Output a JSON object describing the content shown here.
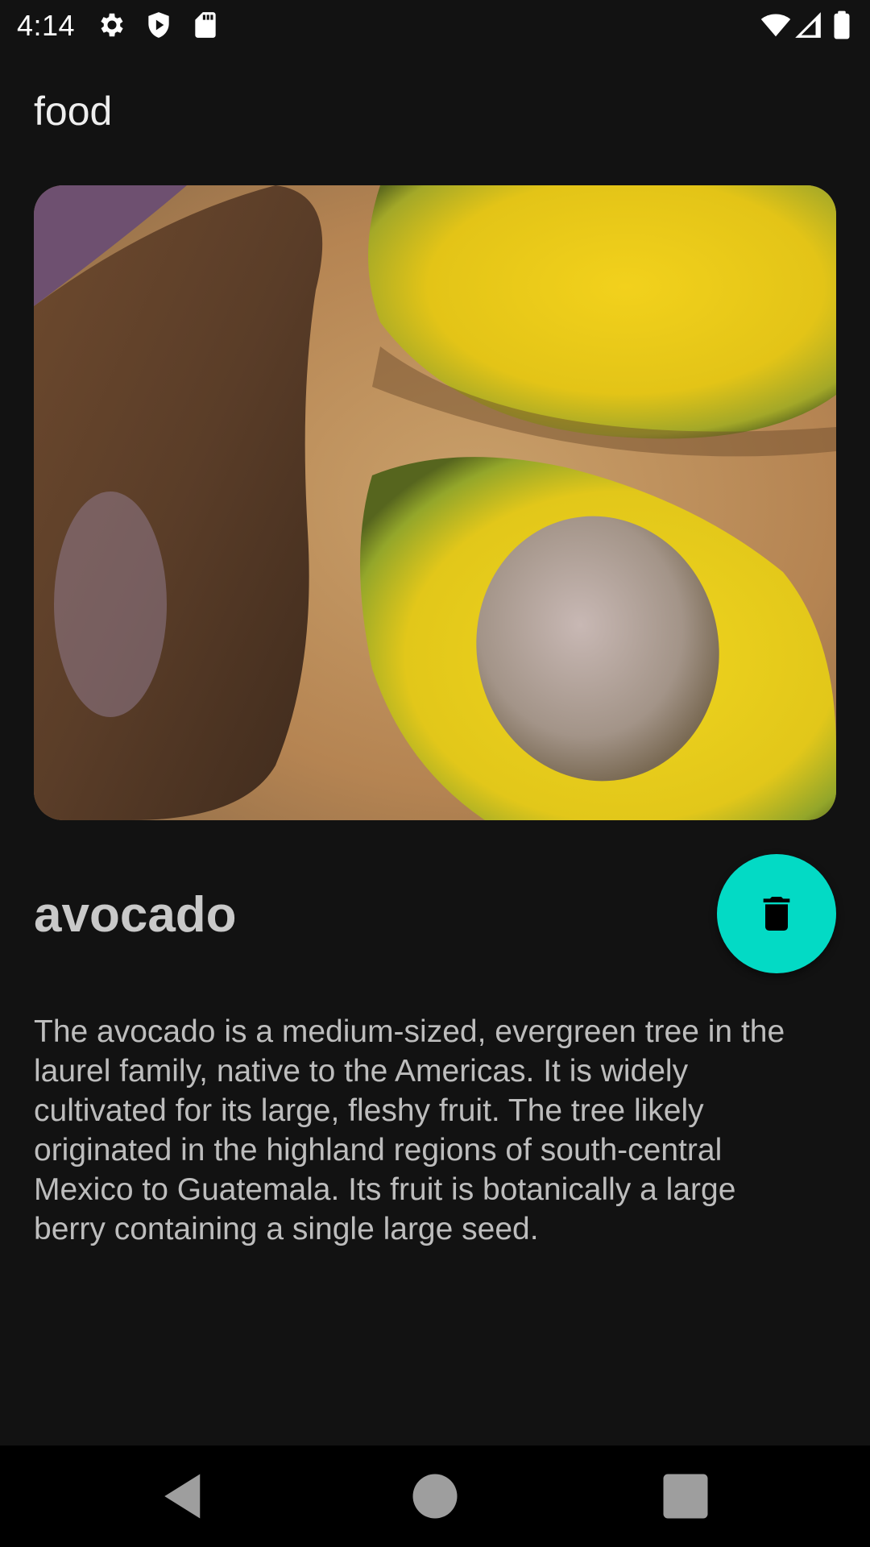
{
  "status_bar": {
    "time": "4:14",
    "icons": [
      "settings-icon",
      "shield-icon",
      "sd-card-icon",
      "wifi-icon",
      "signal-icon",
      "battery-icon"
    ]
  },
  "app_bar": {
    "title": "food"
  },
  "item": {
    "name": "avocado",
    "description": "The avocado is a medium-sized, evergreen tree in the laurel family, native to the Americas. It is widely cultivated for its large, fleshy fruit. The tree likely originated in the highland regions of south-central Mexico to Guatemala. Its fruit is botanically a large berry containing a single large seed.",
    "image_icon": "avocado-photo"
  },
  "delete_button": {
    "icon": "delete-icon",
    "color": "#03dac5"
  },
  "nav_bar": {
    "buttons": [
      "back-icon",
      "home-icon",
      "recents-icon"
    ]
  },
  "colors": {
    "background": "#121212",
    "accent": "#03dac5",
    "nav_background": "#000000"
  }
}
